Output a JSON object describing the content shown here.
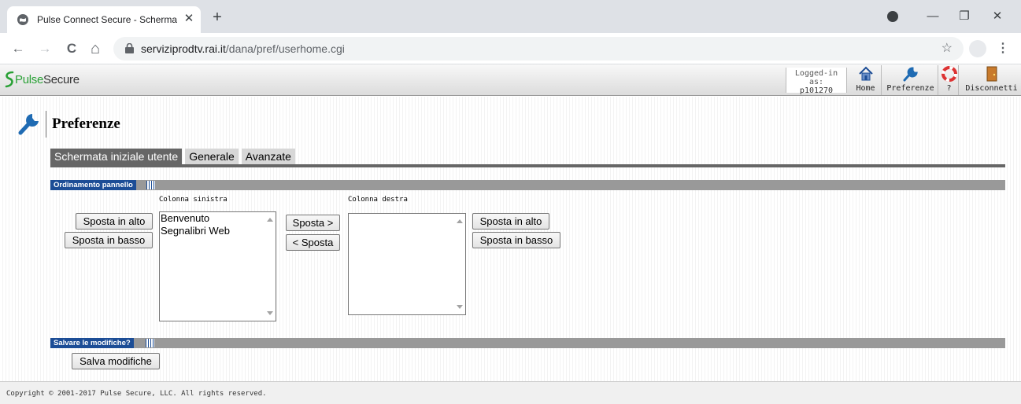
{
  "browser": {
    "tab_title": "Pulse Connect Secure - Schermata",
    "tab_close": "✕",
    "new_tab": "+",
    "url_host": "serviziprodtv.rai.it",
    "url_path": "/dana/pref/userhome.cgi",
    "menu": "⋮",
    "star": "☆",
    "window_controls": {
      "minimize": "—",
      "restore": "❐",
      "close": "✕"
    },
    "nav": {
      "back": "←",
      "forward": "→",
      "reload": "C",
      "home": "⌂"
    }
  },
  "app": {
    "logo_pulse": "Pulse",
    "logo_secure": "Secure",
    "logged_in_label": "Logged-in as:",
    "username": "p101270",
    "header_buttons": {
      "home": "Home",
      "preferences": "Preferenze",
      "help": "?",
      "logout": "Disconnetti"
    }
  },
  "page": {
    "title": "Preferenze",
    "tabs": [
      "Schermata iniziale utente",
      "Generale",
      "Avanzate"
    ],
    "active_tab": "Schermata iniziale utente"
  },
  "panel_order": {
    "section_title": "Ordinamento pannello",
    "left_column": {
      "label": "Colonna sinistra",
      "items": [
        "Benvenuto",
        "Segnalibri Web"
      ]
    },
    "right_column": {
      "label": "Colonna destra",
      "items": []
    },
    "buttons": {
      "move_up": "Sposta in alto",
      "move_down": "Sposta in basso",
      "move_right": "Sposta >",
      "move_left": "< Sposta"
    }
  },
  "save": {
    "section_title": "Salvare le modifiche?",
    "button": "Salva modifiche"
  },
  "footer": {
    "copyright": "Copyright © 2001-2017 Pulse Secure, LLC. All rights reserved."
  },
  "colors": {
    "section_label_bg": "#1c4d96",
    "section_bar_bg": "#999999",
    "active_tab_bg": "#666666",
    "inactive_tab_bg": "#d7d7d7",
    "pulse_green": "#2aa136"
  }
}
